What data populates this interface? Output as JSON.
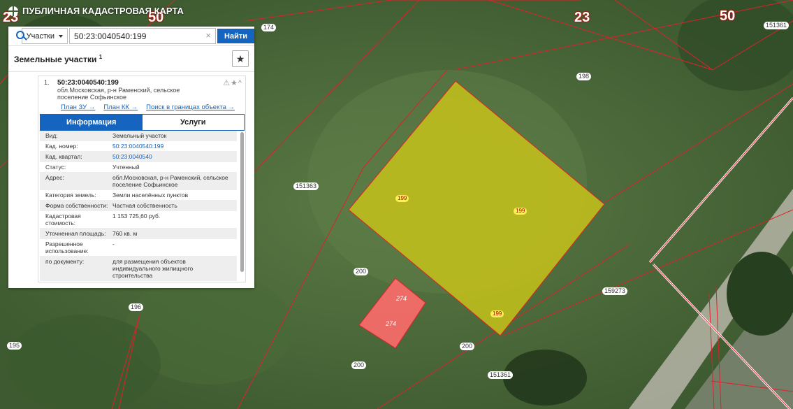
{
  "app": {
    "title": "ПУБЛИЧНАЯ КАДАСТРОВАЯ КАРТА"
  },
  "search": {
    "type_label": "Участки",
    "query": "50:23:0040540:199",
    "find_label": "Найти"
  },
  "panel": {
    "title": "Земельные участки",
    "count": "1"
  },
  "parcel": {
    "index": "1.",
    "number": "50:23:0040540:199",
    "address_short": "обл.Московская, р-н Раменский, сельское поселение Софьинское",
    "links": [
      "План ЗУ →",
      "План КК →",
      "Поиск в границах объекта →"
    ],
    "tabs": [
      "Информация",
      "Услуги"
    ],
    "props": [
      {
        "k": "Вид:",
        "v": "Земельный участок"
      },
      {
        "k": "Кад. номер:",
        "v": "50:23:0040540:199",
        "link": true
      },
      {
        "k": "Кад. квартал:",
        "v": "50:23:0040540",
        "link": true
      },
      {
        "k": "Статус:",
        "v": "Учтенный"
      },
      {
        "k": "Адрес:",
        "v": "обл.Московская, р-н Раменский, сельское поселение Софьинское"
      },
      {
        "k": "Категория земель:",
        "v": "Земли населённых пунктов"
      },
      {
        "k": "Форма собственности:",
        "v": "Частная собственность"
      },
      {
        "k": "Кадастровая стоимость:",
        "v": "1 153 725,60 руб."
      },
      {
        "k": "Уточненная площадь:",
        "v": "760 кв. м"
      },
      {
        "k": "Разрешенное использование:",
        "v": "-"
      },
      {
        "k": "по документу:",
        "v": "для размещения объектов индивидуального жилищного строительства"
      }
    ]
  },
  "map": {
    "region_labels": [
      "23",
      "50",
      "23",
      "50"
    ],
    "parcel_labels": [
      "174",
      "198",
      "151361",
      "151363",
      "199",
      "199",
      "199",
      "200",
      "200",
      "200",
      "274",
      "274",
      "196",
      "195",
      "159273",
      "151361"
    ],
    "colors": {
      "selected_fill": "#c6c21a",
      "pink_fill": "#ff6b6b",
      "boundary": "#e0202a"
    }
  }
}
